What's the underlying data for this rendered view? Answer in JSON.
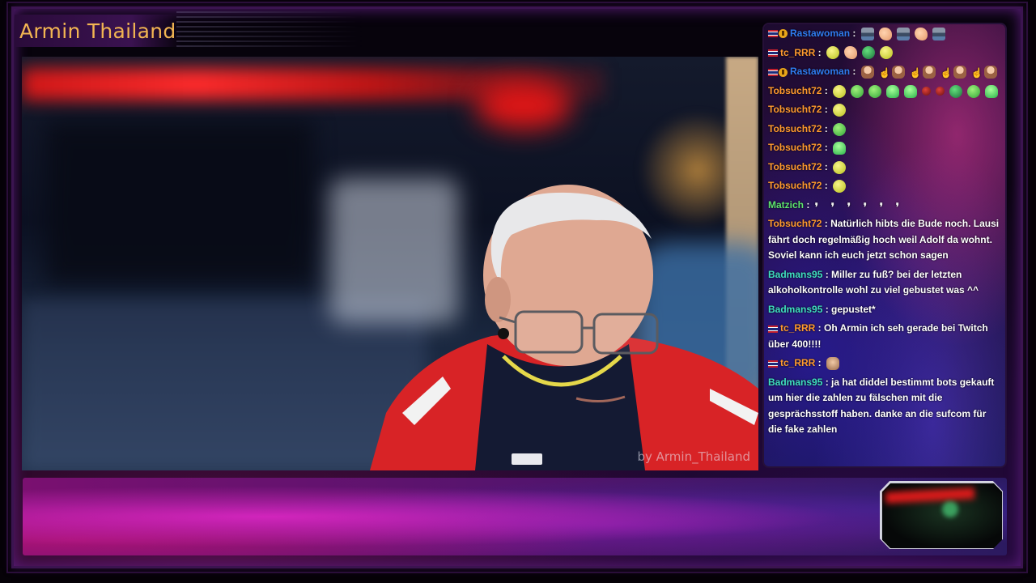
{
  "stream": {
    "title": "Armin Thailand",
    "watermark": "by Armin_Thailand"
  },
  "colors": {
    "title": "#f2b552",
    "name_blue": "#2f7cf0",
    "name_orange": "#ff9a2e",
    "name_green": "#5de36e",
    "name_teal": "#3fe0c0"
  },
  "chat": {
    "messages": [
      {
        "user": "Rastawoman",
        "color": "#2f7cf0",
        "badges": [
          "flag-icon",
          "sub-badge-icon"
        ],
        "text": "",
        "emotes": [
          "dj-emote-icon",
          "paw-emote-icon",
          "dj-emote-icon",
          "paw-emote-icon",
          "dj-emote-icon"
        ]
      },
      {
        "user": "tc_RRR",
        "color": "#ff9a2e",
        "badges": [
          "flag-icon"
        ],
        "text": "",
        "emotes": [
          "yellow-face-emote-icon",
          "paw-emote-icon",
          "globe-emote-icon",
          "yellow-face-emote-icon"
        ]
      },
      {
        "user": "Rastawoman",
        "color": "#2f7cf0",
        "badges": [
          "flag-icon",
          "sub-badge-icon"
        ],
        "text": "",
        "emotes": [
          "kid-emote-icon",
          "hand-emote-icon",
          "kid-emote-icon",
          "hand-emote-icon",
          "kid-emote-icon",
          "hand-emote-icon",
          "kid-emote-icon",
          "hand-emote-icon",
          "kid-emote-icon"
        ]
      },
      {
        "user": "Tobsucht72",
        "color": "#ff9a2e",
        "badges": [],
        "text": "",
        "emotes": [
          "yellow-face-emote-icon",
          "green-face-emote-icon",
          "green-face-emote-icon",
          "green-blob-emote-icon",
          "green-blob-emote-icon",
          "red-face-emote-icon",
          "red-face-emote-icon",
          "globe-emote-icon",
          "green-face-emote-icon",
          "green-blob-emote-icon"
        ]
      },
      {
        "user": "Tobsucht72",
        "color": "#ff9a2e",
        "badges": [],
        "text": "",
        "emotes": [
          "yellow-face-emote-icon"
        ]
      },
      {
        "user": "Tobsucht72",
        "color": "#ff9a2e",
        "badges": [],
        "text": "",
        "emotes": [
          "green-face-emote-icon"
        ]
      },
      {
        "user": "Tobsucht72",
        "color": "#ff9a2e",
        "badges": [],
        "text": "",
        "emotes": [
          "green-blob-emote-icon"
        ]
      },
      {
        "user": "Tobsucht72",
        "color": "#ff9a2e",
        "badges": [],
        "text": "",
        "emotes": [
          "yellow-face-emote-icon"
        ]
      },
      {
        "user": "Tobsucht72",
        "color": "#ff9a2e",
        "badges": [],
        "text": "",
        "emotes": [
          "yellow-face-emote-icon"
        ]
      },
      {
        "user": "Matzich",
        "color": "#5de36e",
        "badges": [],
        "text": "",
        "emotes": [
          "feather-emote-icon",
          "feather-emote-icon",
          "feather-emote-icon",
          "feather-emote-icon",
          "feather-emote-icon",
          "feather-emote-icon"
        ]
      },
      {
        "user": "Tobsucht72",
        "color": "#ff9a2e",
        "badges": [],
        "text": "Natürlich hibts die Bude noch. Lausi fährt doch regelmäßig hoch weil Adolf da wohnt. Soviel kann ich euch jetzt schon sagen",
        "emotes": []
      },
      {
        "user": "Badmans95",
        "color": "#3fe0c0",
        "badges": [],
        "text": "Miller zu fuß? bei der letzten alkoholkontrolle wohl zu viel gebustet was ^^",
        "emotes": []
      },
      {
        "user": "Badmans95",
        "color": "#3fe0c0",
        "badges": [],
        "text": "gepustet*",
        "emotes": []
      },
      {
        "user": "tc_RRR",
        "color": "#ff9a2e",
        "badges": [
          "flag-icon"
        ],
        "text": "Oh Armin ich seh gerade bei Twitch über 400!!!!",
        "emotes": []
      },
      {
        "user": "tc_RRR",
        "color": "#ff9a2e",
        "badges": [
          "flag-icon"
        ],
        "text": "",
        "emotes": [
          "face-emote-icon"
        ]
      },
      {
        "user": "Badmans95",
        "color": "#3fe0c0",
        "badges": [],
        "text": "ja hat diddel bestimmt bots gekauft um hier die zahlen zu fälschen mit die gesprächsstoff haben. danke an die sufcom für die fake zahlen",
        "emotes": []
      }
    ]
  }
}
